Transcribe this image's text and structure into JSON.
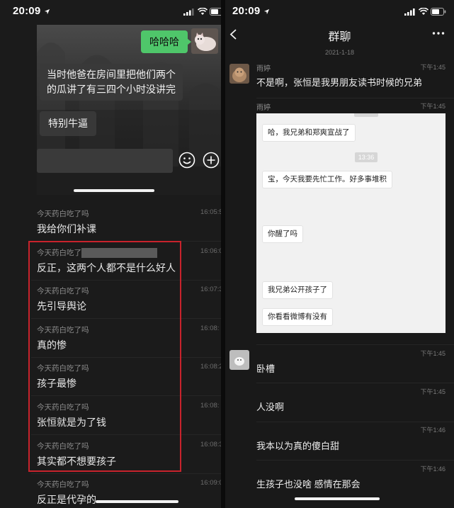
{
  "left": {
    "status_time": "20:09",
    "preview": {
      "sent_bubble": "哈哈哈",
      "received_lines": [
        "当时他爸在房间里把他们两个",
        "的瓜讲了有三四个小时没讲完"
      ],
      "received_short": "特别牛逼"
    },
    "messages": [
      {
        "name": "今天药白吃了吗",
        "time": "16:05:5",
        "text": "我给你们补课"
      },
      {
        "name": "今天药白吃了吗",
        "time": "16:06:0",
        "text": "反正，这两个人都不是什么好人"
      },
      {
        "name": "今天药白吃了吗",
        "time": "16:07:3",
        "text": "先引导舆论"
      },
      {
        "name": "今天药白吃了吗",
        "time": "16:08:",
        "text": "真的惨"
      },
      {
        "name": "今天药白吃了吗",
        "time": "16:08:2",
        "text": "孩子最惨"
      },
      {
        "name": "今天药白吃了吗",
        "time": "16:08:",
        "text": "张恒就是为了钱"
      },
      {
        "name": "今天药白吃了吗",
        "time": "16:08:3",
        "text": "其实都不想要孩子"
      },
      {
        "name": "今天药白吃了吗",
        "time": "16:09:0",
        "text": "反正是代孕的"
      }
    ]
  },
  "right": {
    "status_time": "20:09",
    "title": "群聊",
    "date": "2021-1-18",
    "messages": [
      {
        "name": "雨婷",
        "time": "下午1:45",
        "text": "不是啊，张恒是我男朋友读书时候的兄弟"
      },
      {
        "name": "雨婷",
        "time": "下午1:45",
        "image_timestamp": "13:36",
        "image_bubbles": [
          "哈，我兄弟和郑爽宣战了",
          "宝，今天我要先忙工作。好多事堆积",
          "你醒了吗",
          "我兄弟公开孩子了",
          "你看看微博有没有"
        ]
      },
      {
        "time": "下午1:45",
        "text": "卧槽"
      },
      {
        "time": "下午1:45",
        "text": "人没啊"
      },
      {
        "time": "下午1:46",
        "text": "我本以为真的傻白甜"
      },
      {
        "time": "下午1:46",
        "text": "生孩子也没啥 感情在那会"
      }
    ]
  },
  "icons": [
    "location-arrow-icon",
    "signal-icon",
    "wifi-icon",
    "battery-icon",
    "emoji-icon",
    "plus-icon",
    "back-chevron-icon",
    "more-icon"
  ],
  "colors": {
    "highlight": "#c8232c",
    "sent_bubble": "#4fc66a",
    "background": "#1b1b1b"
  }
}
